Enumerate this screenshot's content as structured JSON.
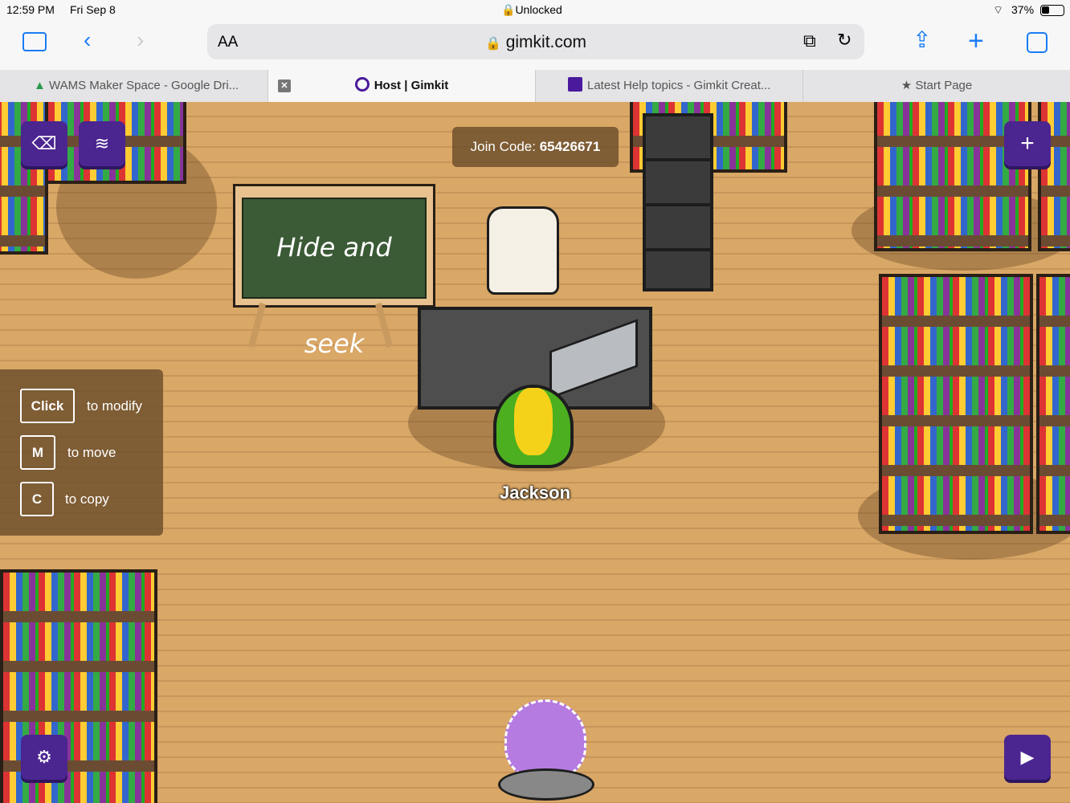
{
  "status": {
    "time": "12:59 PM",
    "date": "Fri Sep 8",
    "lock": "Unlocked",
    "battery": "37%"
  },
  "browser": {
    "text_size": "AA",
    "url": "gimkit.com"
  },
  "tabs": [
    {
      "label": "WAMS Maker Space - Google Dri..."
    },
    {
      "label": "Host | Gimkit",
      "active": true
    },
    {
      "label": "Latest Help topics - Gimkit Creat..."
    },
    {
      "label": "Start Page"
    }
  ],
  "game": {
    "join_label": "Join Code:",
    "join_code": "65426671",
    "chalkboard": "Hide and seek",
    "player": "Jackson",
    "hints": [
      {
        "key": "Click",
        "text": "to modify"
      },
      {
        "key": "M",
        "text": "to move"
      },
      {
        "key": "C",
        "text": "to copy"
      }
    ]
  },
  "colors": {
    "accent": "#4b2590",
    "floor": "#d9a766",
    "chalkboard": "#3b5a36"
  }
}
